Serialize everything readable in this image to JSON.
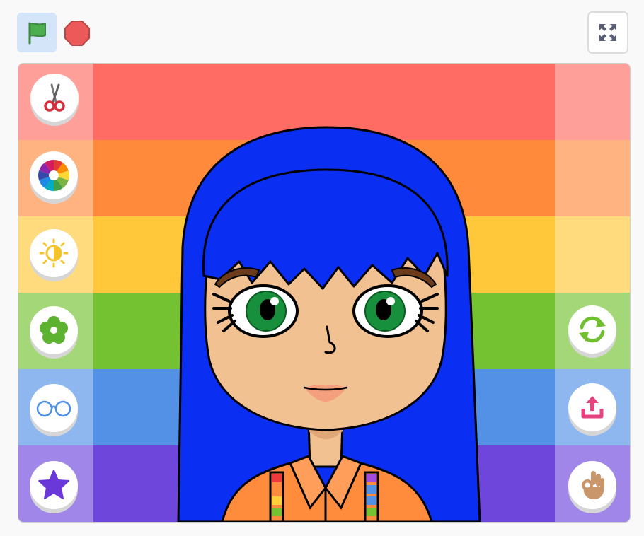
{
  "toolbar": {
    "green_flag_icon": "green-flag-icon",
    "stop_icon": "stop-icon",
    "fullscreen_icon": "fullscreen-icon"
  },
  "stage": {
    "stripe_colors": [
      "#ff6c63",
      "#ff8a3c",
      "#ffc83a",
      "#74c231",
      "#5291e6",
      "#6e46dc"
    ],
    "left_buttons": [
      {
        "name": "haircut-button",
        "icon": "scissors-icon"
      },
      {
        "name": "hair-color-button",
        "icon": "color-wheel-icon"
      },
      {
        "name": "brightness-button",
        "icon": "brightness-icon"
      },
      {
        "name": "flower-button",
        "icon": "flower-icon"
      },
      {
        "name": "glasses-button",
        "icon": "glasses-icon"
      },
      {
        "name": "star-button",
        "icon": "star-icon"
      }
    ],
    "right_buttons": [
      {
        "name": "reset-button",
        "icon": "refresh-icon"
      },
      {
        "name": "share-button",
        "icon": "upload-icon"
      },
      {
        "name": "ok-gesture-button",
        "icon": "ok-hand-icon"
      }
    ],
    "character": {
      "hair_color": "#0a2ef2",
      "skin_color": "#f2c191",
      "eye_color": "#178f3c",
      "shirt_color": "#ff8b3d"
    }
  }
}
